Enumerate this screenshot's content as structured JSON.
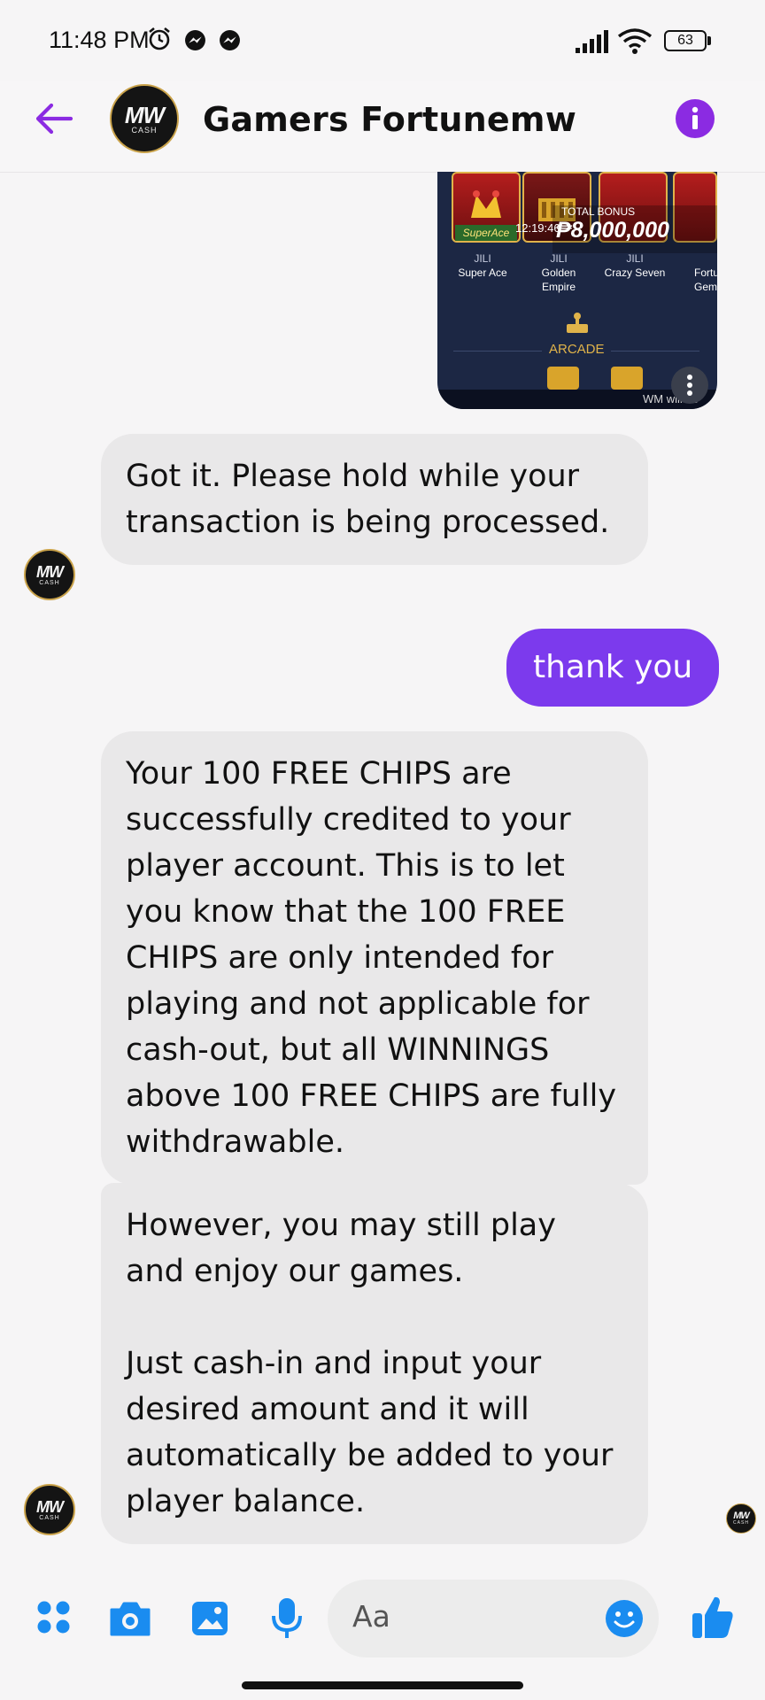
{
  "status_bar": {
    "time": "11:48 PM",
    "battery": "63"
  },
  "header": {
    "title": "Gamers Fortunemw",
    "avatar_mark": "MW",
    "avatar_sub": "CASH"
  },
  "game_card": {
    "games": [
      {
        "provider": "JILI",
        "name": "Super Ace"
      },
      {
        "provider": "JILI",
        "name": "Golden Empire"
      },
      {
        "provider": "JILI",
        "name": "Crazy Seven"
      },
      {
        "provider": "",
        "name": "Fortune Gems"
      }
    ],
    "thumb_label": "SuperAce",
    "timer": "12:19:46",
    "bonus_title": "TOTAL BONUS",
    "bonus_amount": "₱8,000,000",
    "section_label": "ARCADE",
    "watermark": "WM will be"
  },
  "messages": [
    {
      "sender": "page",
      "text": "Got it. Please hold while your transaction is being processed."
    },
    {
      "sender": "me",
      "text": "thank you"
    },
    {
      "sender": "page",
      "text": "Your 100 FREE CHIPS are successfully credited to your player account. This is to let you know that the 100 FREE CHIPS are only intended for playing and not applicable for cash-out, but all WINNINGS above 100 FREE CHIPS are fully withdrawable."
    },
    {
      "sender": "page",
      "text": "However, you may still play and enjoy our games.\n\nJust cash-in and input your desired amount and it will automatically be added to your player balance."
    }
  ],
  "composer": {
    "placeholder": "Aa"
  },
  "colors": {
    "accent": "#7c3aed",
    "messenger_blue": "#1a8cf0",
    "bubble_in": "#e9e8e9",
    "card_bg": "#1c2744"
  }
}
